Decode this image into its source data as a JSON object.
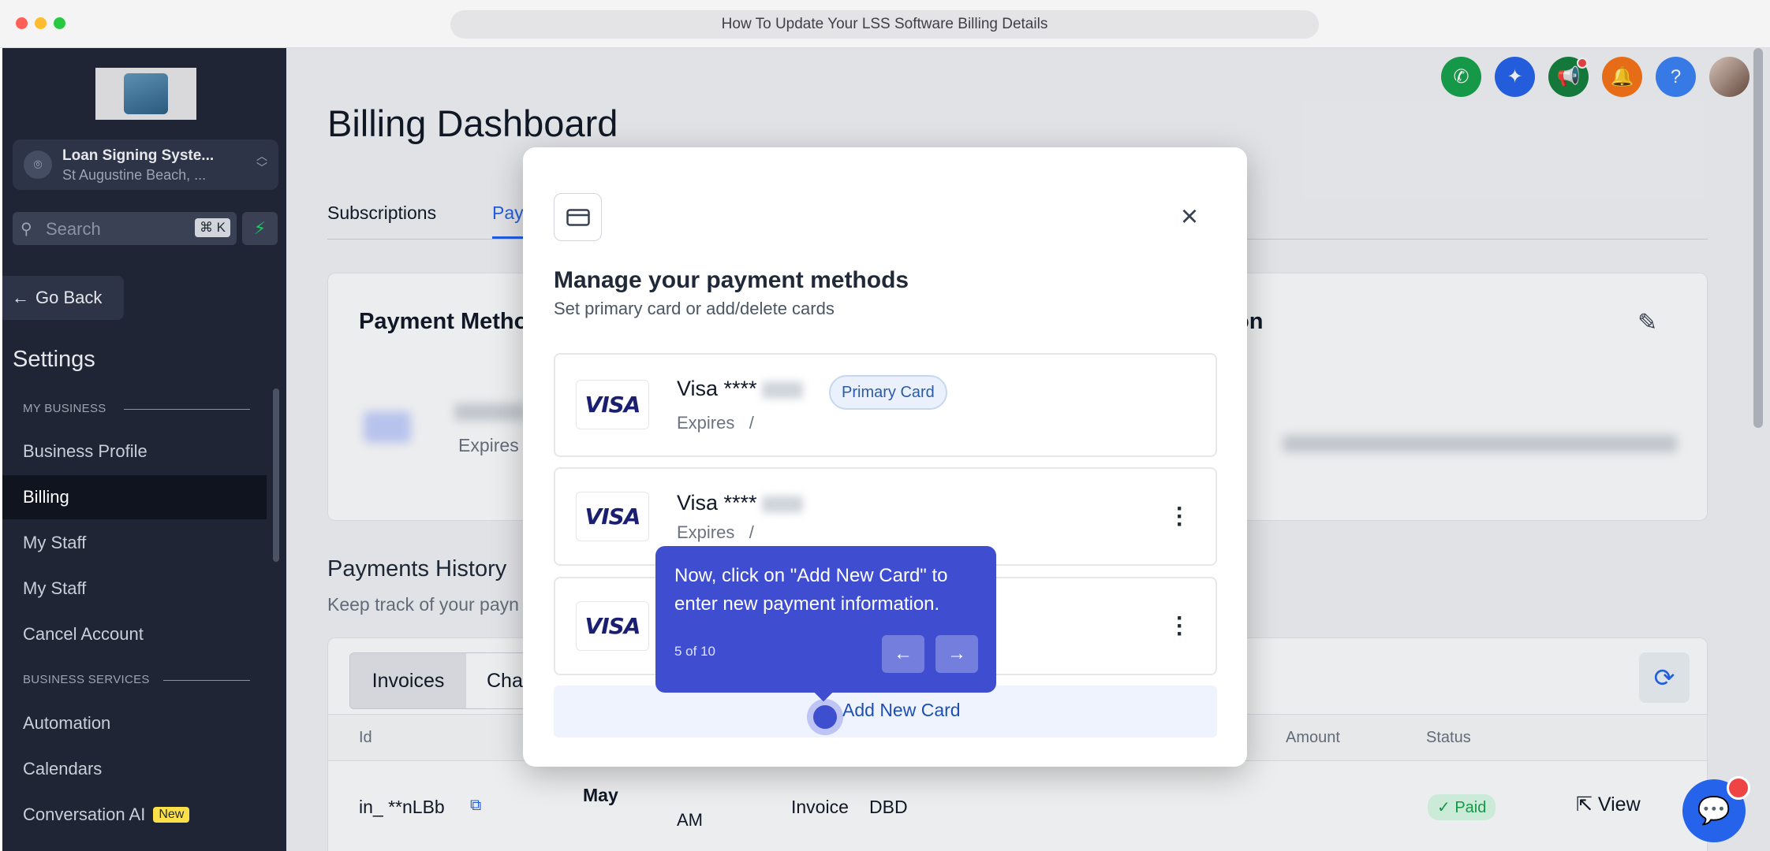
{
  "browser": {
    "title": "How To Update Your LSS Software Billing Details"
  },
  "sidebar": {
    "location_name": "Loan Signing Syste...",
    "location_sub": "St Augustine Beach, ...",
    "search_placeholder": "Search",
    "search_shortcut": "⌘ K",
    "go_back": "Go Back",
    "settings_title": "Settings",
    "section_my_business": "MY BUSINESS",
    "section_business_services": "BUSINESS SERVICES",
    "items": [
      {
        "label": "Business Profile"
      },
      {
        "label": "Billing"
      },
      {
        "label": "My Staff"
      },
      {
        "label": "My Staff"
      },
      {
        "label": "Cancel Account"
      },
      {
        "label": "Automation"
      },
      {
        "label": "Calendars"
      },
      {
        "label": "Conversation AI",
        "badge": "New"
      }
    ]
  },
  "main": {
    "page_title": "Billing Dashboard",
    "tabs": [
      {
        "label": "Subscriptions"
      },
      {
        "label": "Pay"
      }
    ],
    "payment_methods_title": "Payment Metho",
    "expires": "Expires",
    "billing_info_title_tail": "on",
    "payments_history_title": "Payments History",
    "payments_history_sub": "Keep track of your payn",
    "history_tabs": [
      {
        "label": "Invoices"
      },
      {
        "label": "Cha"
      }
    ],
    "table_headers": {
      "id": "Id",
      "amount": "Amount",
      "status": "Status"
    },
    "row": {
      "id": "in_ **nLBb",
      "date": "May",
      "time_suffix": "AM",
      "type": "Invoice",
      "type_id": "DBD",
      "status": "Paid",
      "action": "View"
    }
  },
  "modal": {
    "title": "Manage your payment methods",
    "subtitle": "Set primary card or add/delete cards",
    "cards": [
      {
        "brand": "VISA",
        "name": "Visa ****",
        "expires": "Expires",
        "primary_badge": "Primary Card"
      },
      {
        "brand": "VISA",
        "name": "Visa ****",
        "expires": "Expires"
      },
      {
        "brand": "VISA"
      }
    ],
    "add_card_label": "Add New Card"
  },
  "tooltip": {
    "text": "Now, click on \"Add New Card\" to enter new payment information.",
    "step": "5 of 10"
  },
  "colors": {
    "sidebar_bg": "#1f2535",
    "accent": "#2563eb",
    "tooltip_bg": "#3f4dd0",
    "paid_green": "#16a34a"
  }
}
